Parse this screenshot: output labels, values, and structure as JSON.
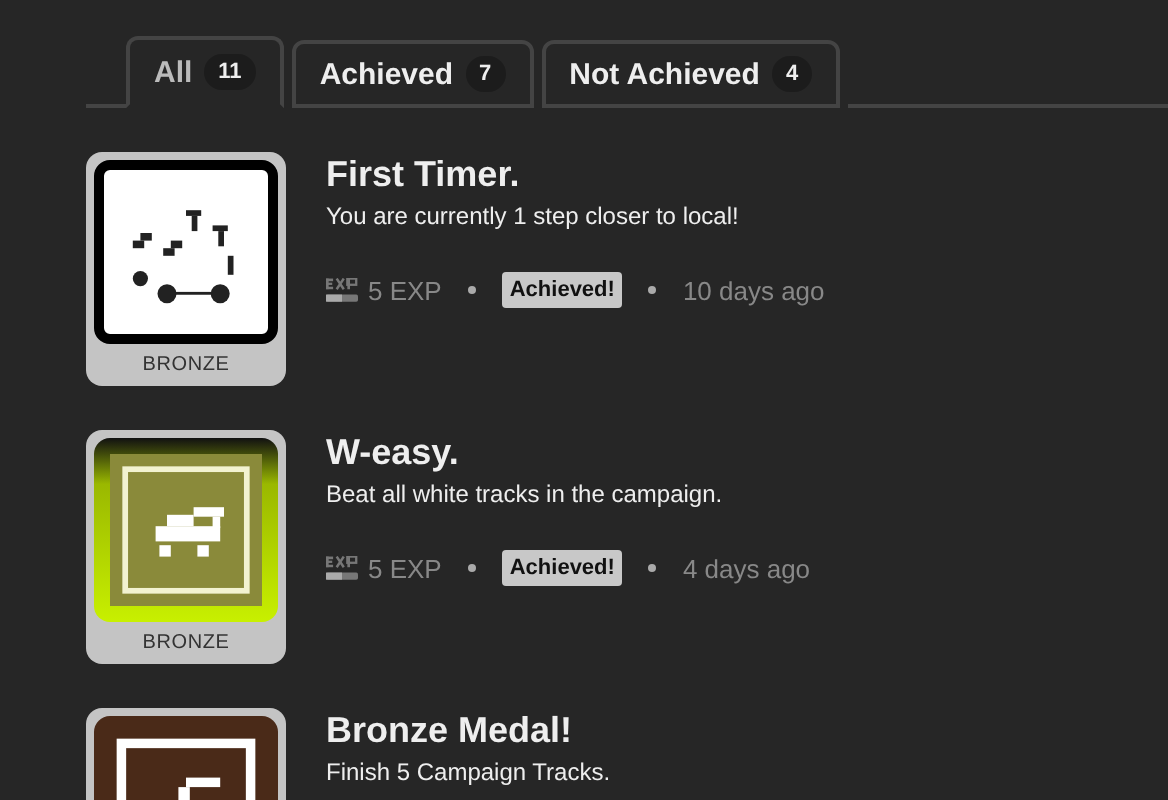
{
  "tabs": [
    {
      "label": "All",
      "count": "11",
      "selected": true
    },
    {
      "label": "Achieved",
      "count": "7",
      "selected": false
    },
    {
      "label": "Not Achieved",
      "count": "4",
      "selected": false
    }
  ],
  "achievements": [
    {
      "kind": "white",
      "tier": "BRONZE",
      "title": "First Timer.",
      "description": "You are currently 1 step closer to local!",
      "exp": "5 EXP",
      "status": "Achieved!",
      "time": "10 days ago"
    },
    {
      "kind": "green",
      "tier": "BRONZE",
      "title": "W-easy.",
      "description": "Beat all white tracks in the campaign.",
      "exp": "5 EXP",
      "status": "Achieved!",
      "time": "4 days ago"
    },
    {
      "kind": "brown",
      "title": "Bronze Medal!",
      "description": "Finish 5 Campaign Tracks."
    }
  ]
}
